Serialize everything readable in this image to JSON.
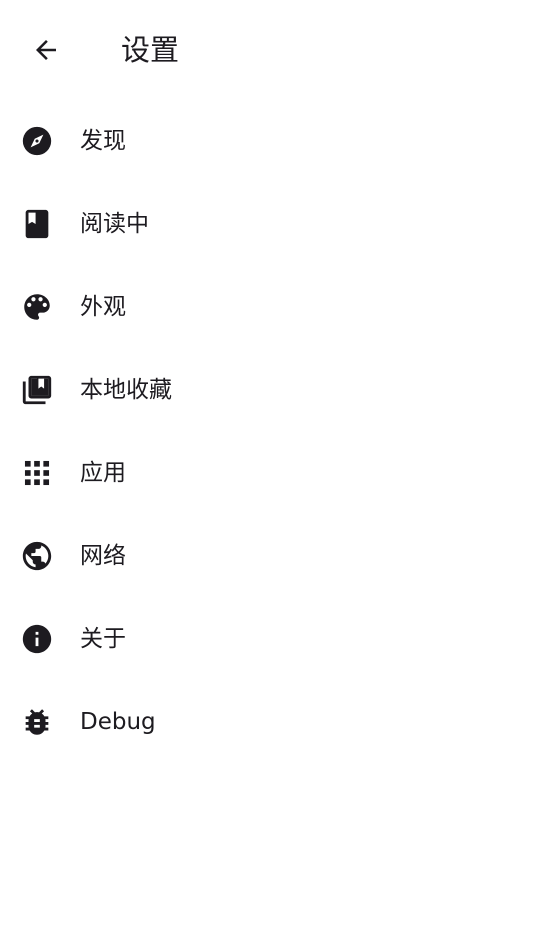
{
  "header": {
    "title": "设置",
    "back_icon": "arrow-back-icon"
  },
  "settings": {
    "items": [
      {
        "label": "发现",
        "icon": "compass-icon"
      },
      {
        "label": "阅读中",
        "icon": "book-icon"
      },
      {
        "label": "外观",
        "icon": "palette-icon"
      },
      {
        "label": "本地收藏",
        "icon": "library-bookmark-icon"
      },
      {
        "label": "应用",
        "icon": "apps-grid-icon"
      },
      {
        "label": "网络",
        "icon": "globe-icon"
      },
      {
        "label": "关于",
        "icon": "info-icon"
      },
      {
        "label": "Debug",
        "icon": "bug-icon"
      }
    ]
  },
  "colors": {
    "background": "#ffffff",
    "text": "#1d1b20",
    "icon": "#1d1b20"
  }
}
